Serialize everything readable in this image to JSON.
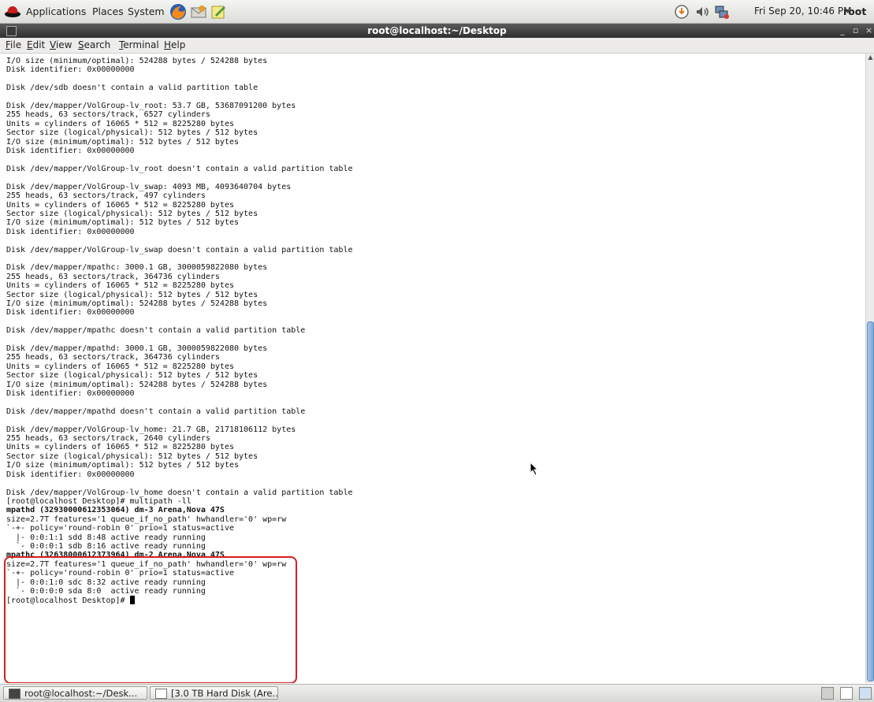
{
  "top_panel": {
    "menus": [
      "Applications",
      "Places",
      "System"
    ],
    "clock": "Fri Sep 20, 10:46 PM",
    "user": "root"
  },
  "window": {
    "title": "root@localhost:~/Desktop",
    "buttons": [
      "_",
      "▫",
      "×"
    ]
  },
  "menu_bar": {
    "items": [
      {
        "key": "F",
        "rest": "ile"
      },
      {
        "key": "E",
        "rest": "dit"
      },
      {
        "key": "V",
        "rest": "iew"
      },
      {
        "key": "S",
        "rest": "earch"
      },
      {
        "key": "T",
        "rest": "erminal"
      },
      {
        "key": "H",
        "rest": "elp"
      }
    ]
  },
  "terminal": {
    "lines": [
      "I/O size (minimum/optimal): 524288 bytes / 524288 bytes",
      "Disk identifier: 0x00000000",
      "",
      "Disk /dev/sdb doesn't contain a valid partition table",
      "",
      "Disk /dev/mapper/VolGroup-lv_root: 53.7 GB, 53687091200 bytes",
      "255 heads, 63 sectors/track, 6527 cylinders",
      "Units = cylinders of 16065 * 512 = 8225280 bytes",
      "Sector size (logical/physical): 512 bytes / 512 bytes",
      "I/O size (minimum/optimal): 512 bytes / 512 bytes",
      "Disk identifier: 0x00000000",
      "",
      "Disk /dev/mapper/VolGroup-lv_root doesn't contain a valid partition table",
      "",
      "Disk /dev/mapper/VolGroup-lv_swap: 4093 MB, 4093640704 bytes",
      "255 heads, 63 sectors/track, 497 cylinders",
      "Units = cylinders of 16065 * 512 = 8225280 bytes",
      "Sector size (logical/physical): 512 bytes / 512 bytes",
      "I/O size (minimum/optimal): 512 bytes / 512 bytes",
      "Disk identifier: 0x00000000",
      "",
      "Disk /dev/mapper/VolGroup-lv_swap doesn't contain a valid partition table",
      "",
      "Disk /dev/mapper/mpathc: 3000.1 GB, 3000059822080 bytes",
      "255 heads, 63 sectors/track, 364736 cylinders",
      "Units = cylinders of 16065 * 512 = 8225280 bytes",
      "Sector size (logical/physical): 512 bytes / 512 bytes",
      "I/O size (minimum/optimal): 524288 bytes / 524288 bytes",
      "Disk identifier: 0x00000000",
      "",
      "Disk /dev/mapper/mpathc doesn't contain a valid partition table",
      "",
      "Disk /dev/mapper/mpathd: 3000.1 GB, 3000059822080 bytes",
      "255 heads, 63 sectors/track, 364736 cylinders",
      "Units = cylinders of 16065 * 512 = 8225280 bytes",
      "Sector size (logical/physical): 512 bytes / 512 bytes",
      "I/O size (minimum/optimal): 524288 bytes / 524288 bytes",
      "Disk identifier: 0x00000000",
      "",
      "Disk /dev/mapper/mpathd doesn't contain a valid partition table",
      "",
      "Disk /dev/mapper/VolGroup-lv_home: 21.7 GB, 21718106112 bytes",
      "255 heads, 63 sectors/track, 2640 cylinders",
      "Units = cylinders of 16065 * 512 = 8225280 bytes",
      "Sector size (logical/physical): 512 bytes / 512 bytes",
      "I/O size (minimum/optimal): 512 bytes / 512 bytes",
      "Disk identifier: 0x00000000",
      "",
      "Disk /dev/mapper/VolGroup-lv_home doesn't contain a valid partition table",
      "[root@localhost Desktop]# multipath -ll",
      "mpathd (32930000612353064) dm-3 Arena,Nova 47S",
      "size=2.7T features='1 queue_if_no_path' hwhandler='0' wp=rw",
      "`-+- policy='round-robin 0' prio=1 status=active",
      "  |- 0:0:1:1 sdd 8:48 active ready running",
      "  `- 0:0:0:1 sdb 8:16 active ready running",
      "mpathc (32638000612373964) dm-2 Arena,Nova 47S",
      "size=2.7T features='1 queue_if_no_path' hwhandler='0' wp=rw",
      "`-+- policy='round-robin 0' prio=1 status=active",
      "  |- 0:0:1:0 sdc 8:32 active ready running",
      "  `- 0:0:0:0 sda 8:0  active ready running"
    ],
    "bold_lines": [
      50,
      55
    ],
    "prompt": "[root@localhost Desktop]# "
  },
  "taskbar": {
    "tasks": [
      "root@localhost:~/Desk...",
      "[3.0 TB Hard Disk (Are..."
    ]
  },
  "colors": {
    "highlight_border": "#d61e1e",
    "title_bar": "#3c3c3c",
    "scroll_thumb": "#8fb3dd"
  }
}
